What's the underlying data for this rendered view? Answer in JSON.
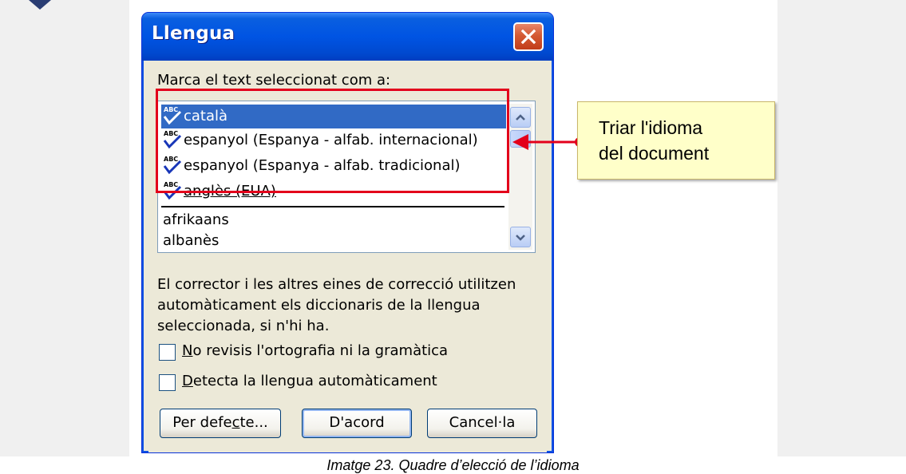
{
  "dialog": {
    "title": "Llengua",
    "list_label_prefix": "Marca el text seleccionat com a:",
    "languages": [
      {
        "label": "català",
        "selected": true,
        "spell_icon": true
      },
      {
        "label": "espanyol (Espanya - alfab. internacional)",
        "selected": false,
        "spell_icon": true
      },
      {
        "label": "espanyol (Espanya - alfab. tradicional)",
        "selected": false,
        "spell_icon": true
      },
      {
        "label": "anglès (EUA)",
        "selected": false,
        "spell_icon": true
      },
      {
        "label": "afrikaans",
        "selected": false,
        "spell_icon": false
      },
      {
        "label": "albanès",
        "selected": false,
        "spell_icon": false
      }
    ],
    "description_lines": [
      "El corrector i les altres eines de correcció utilitzen",
      "automàticament els diccionaris de la llengua",
      "seleccionada, si n'hi ha."
    ],
    "checkbox_no_spell": {
      "prefix": "",
      "accel": "N",
      "rest": "o revisis l'ortografia ni la gramàtica",
      "checked": false
    },
    "checkbox_detect": {
      "prefix": "",
      "accel": "D",
      "rest": "etecta la llengua automàticament",
      "checked": false
    },
    "buttons": {
      "default_prefix": "Per defe",
      "default_accel": "c",
      "default_rest": "te...",
      "ok": "D'acord",
      "cancel": "Cancel·la"
    }
  },
  "callout": {
    "line1": "Triar l'idioma",
    "line2": "del document"
  },
  "caption": "Imatge 23. Quadre d’elecció de l’idioma",
  "colors": {
    "selection": "#316ac5",
    "titlebar": "#0054e3",
    "annotation_red": "#e3001b",
    "callout_fill": "#ffffc9"
  },
  "icons": {
    "close": "close-x-icon",
    "spellcheck": "abc-check-icon",
    "scroll_up": "chevron-up-icon",
    "scroll_down": "chevron-down-icon"
  }
}
